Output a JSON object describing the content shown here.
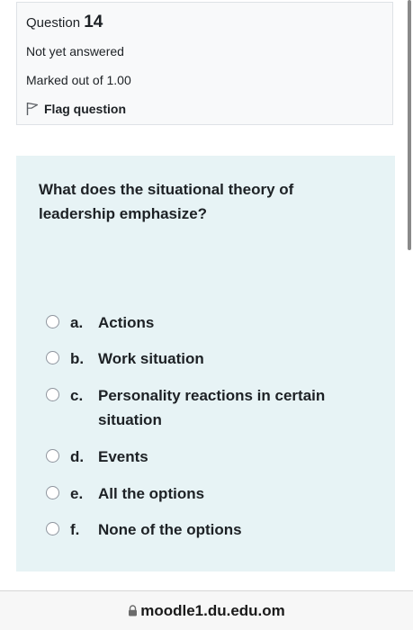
{
  "question_info": {
    "prefix": "Question",
    "number": "14",
    "state": "Not yet answered",
    "grade": "Marked out of 1.00",
    "flag_label": "Flag question",
    "flag_icon": "flag-outline-icon"
  },
  "question": {
    "text": "What does the situational theory of leadership emphasize?",
    "answers": [
      {
        "letter": "a.",
        "text": "Actions"
      },
      {
        "letter": "b.",
        "text": "Work situation"
      },
      {
        "letter": "c.",
        "text": "Personality reactions in certain situation"
      },
      {
        "letter": "d.",
        "text": "Events"
      },
      {
        "letter": "e.",
        "text": "All the options"
      },
      {
        "letter": "f.",
        "text": "None of the options"
      }
    ]
  },
  "browser": {
    "url": "moodle1.du.edu.om",
    "lock_icon": "lock-icon"
  },
  "colors": {
    "info_background": "#f8f9fa",
    "content_background": "#e7f3f5",
    "text": "#1d2125"
  }
}
